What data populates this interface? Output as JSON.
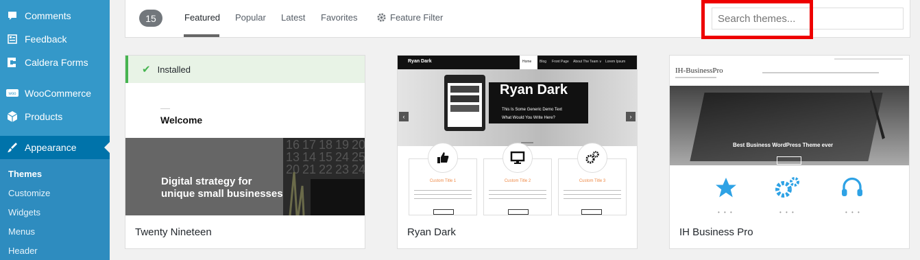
{
  "sidebar": {
    "items": [
      {
        "label": "Comments",
        "icon": "comment-icon"
      },
      {
        "label": "Feedback",
        "icon": "feedback-icon"
      },
      {
        "label": "Caldera Forms",
        "icon": "caldera-icon"
      },
      {
        "label": "WooCommerce",
        "icon": "woocommerce-icon"
      },
      {
        "label": "Products",
        "icon": "box-icon"
      },
      {
        "label": "Appearance",
        "icon": "paintbrush-icon"
      }
    ],
    "submenu": [
      "Themes",
      "Customize",
      "Widgets",
      "Menus",
      "Header"
    ]
  },
  "filter": {
    "count": "15",
    "tabs": [
      "Featured",
      "Popular",
      "Latest",
      "Favorites"
    ],
    "feature_filter": "Feature Filter",
    "search_placeholder": "Search themes..."
  },
  "themes": [
    {
      "name": "Twenty Nineteen",
      "installed": "Installed",
      "welcome": "Welcome",
      "hero_line1": "Digital strategy for",
      "hero_line2": "unique small businesses"
    },
    {
      "name": "Ryan Dark",
      "brand": "Ryan Dark",
      "menu": [
        "Home",
        "Blog",
        "Front Page",
        "About The Team ∨",
        "Lorem Ipsum"
      ],
      "hero_title": "Ryan Dark",
      "hero_sub1": "This Is Some Generic Demo Text",
      "hero_sub2": "What Would You Write Here?",
      "features": [
        "Custom Title 1",
        "Custom Title 2",
        "Custom Title 3"
      ]
    },
    {
      "name": "IH Business Pro",
      "brand": "IH-BusinessPro",
      "hero_text": "Best Business WordPress Theme ever"
    }
  ],
  "colors": {
    "sidebar": "#3498c9",
    "sidebar_current": "#0073aa",
    "installed_green": "#46b450",
    "highlight": "#ee0000",
    "ih_icon_blue": "#2ea2e5"
  }
}
